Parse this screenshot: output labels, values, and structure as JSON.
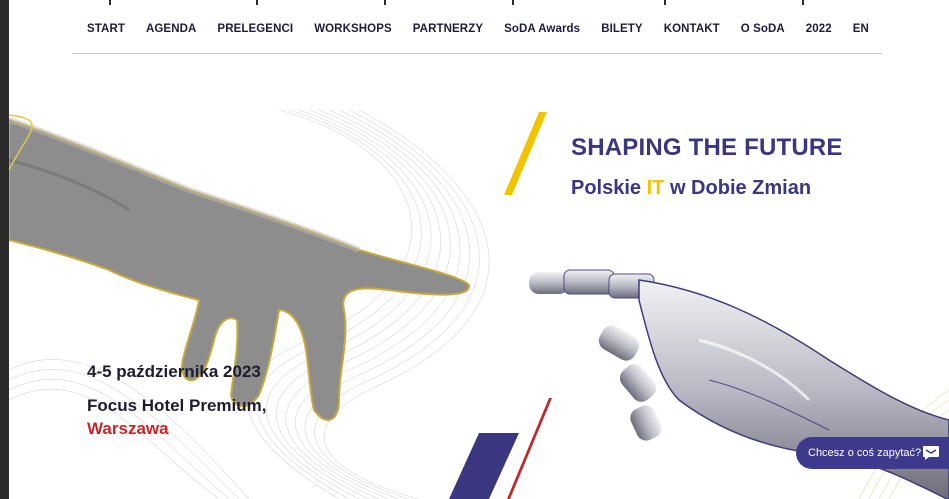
{
  "nav": {
    "items": [
      {
        "label": "START",
        "name": "nav-start"
      },
      {
        "label": "AGENDA",
        "name": "nav-agenda"
      },
      {
        "label": "PRELEGENCI",
        "name": "nav-prelegenci"
      },
      {
        "label": "WORKSHOPS",
        "name": "nav-workshops"
      },
      {
        "label": "PARTNERZY",
        "name": "nav-partnerzy"
      },
      {
        "label": "SoDA Awards",
        "name": "nav-soda-awards"
      },
      {
        "label": "BILETY",
        "name": "nav-bilety"
      },
      {
        "label": "KONTAKT",
        "name": "nav-kontakt"
      },
      {
        "label": "O SoDA",
        "name": "nav-o-soda"
      },
      {
        "label": "2022",
        "name": "nav-2022"
      },
      {
        "label": "EN",
        "name": "nav-en"
      }
    ]
  },
  "hero": {
    "title": "SHAPING THE FUTURE",
    "subtitle_before": "Polskie ",
    "subtitle_highlight": "IT",
    "subtitle_after": " w Dobie Zmian",
    "date": "4-5 października 2023",
    "venue": "Focus Hotel Premium,",
    "city": "Warszawa"
  },
  "chat": {
    "label": "Chcesz o coś zapytać?",
    "icon": "chat-bubble-icon"
  },
  "colors": {
    "brand_navy": "#3b3680",
    "accent_yellow": "#f2c300",
    "accent_red": "#c0292b",
    "chat_bg": "#3d3a8c"
  }
}
